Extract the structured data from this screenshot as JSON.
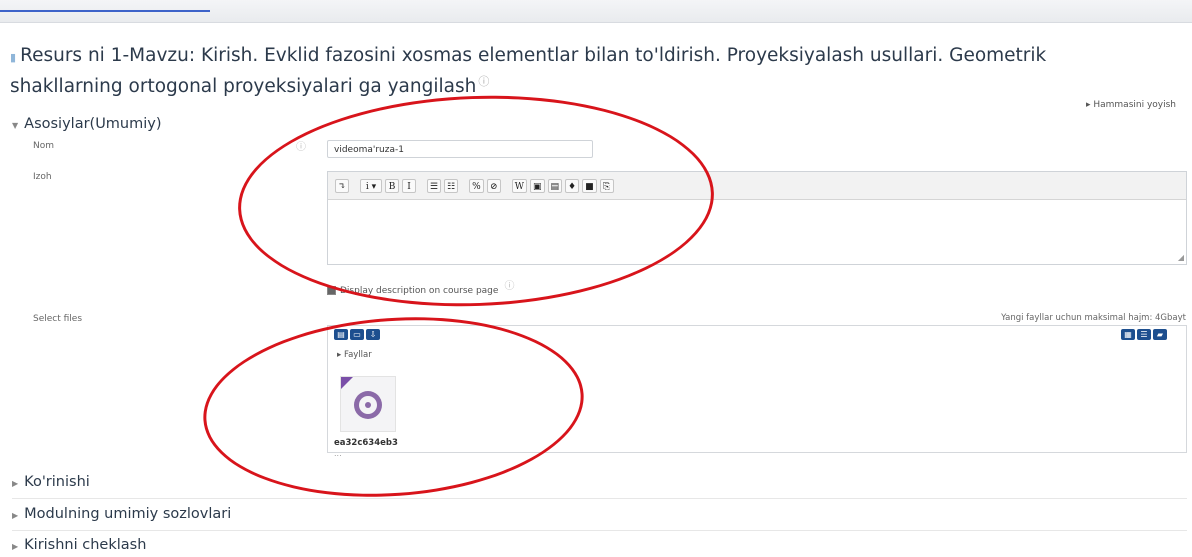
{
  "page": {
    "title": "Resurs ni 1-Mavzu: Kirish. Evklid fazosini xosmas elementlar bilan to'ldirish. Proyeksiyalash usullari. Geometrik shakllarning ortogonal proyeksiyalari ga yangilash",
    "expand_all": "Hammasini yoyish"
  },
  "general": {
    "heading": "Asosiylar(Umumiy)",
    "name_label": "Nom",
    "name_value": "videoma'ruza-1",
    "desc_label": "Izoh",
    "display_desc": "Display description on course page",
    "select_files_label": "Select files",
    "max_size": "Yangi fayllar uchun maksimal hajm: 4Gbayt"
  },
  "editor": {
    "buttons": [
      "↴",
      "i ▾",
      "B",
      "I",
      "☰",
      "☷",
      "%",
      "⊘",
      "W",
      "▣",
      "▤",
      "♦",
      "■",
      "⎘"
    ]
  },
  "filepicker": {
    "crumb": "Fayllar",
    "file_name": "ea32c634eb3",
    "file_name_cont": "..."
  },
  "sections": {
    "view": "Ko'rinishi",
    "common": "Modulning umimiy sozlovlari",
    "restrict": "Kirishni cheklash"
  },
  "colors": {
    "annotation": "#d8141b",
    "icon_button": "#1d4f8f"
  }
}
